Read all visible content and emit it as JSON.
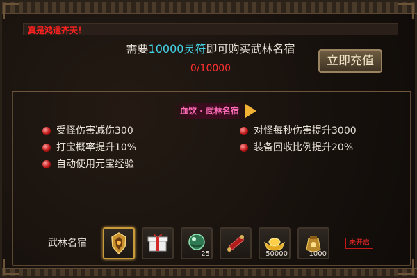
{
  "ticker": {
    "message": "真是鸿运齐天！"
  },
  "purchase": {
    "prefix": "需要",
    "amount_currency": "10000灵符",
    "suffix": "即可购买武林名宿",
    "progress": "0/10000"
  },
  "buttons": {
    "recharge_label": "立即充值"
  },
  "title_badge": {
    "label": "血饮 · 武林名宿"
  },
  "perks": {
    "left": [
      "受怪伤害减伤300",
      "打宝概率提升10%",
      "自动使用元宝经验"
    ],
    "right": [
      "对怪每秒伤害提升3000",
      "装备回收比例提升20%"
    ]
  },
  "reward_set": {
    "label": "武林名宿",
    "items": [
      {
        "icon": "golden-armor-icon",
        "qty": ""
      },
      {
        "icon": "gift-box-icon",
        "qty": ""
      },
      {
        "icon": "green-orb-icon",
        "qty": "25"
      },
      {
        "icon": "scroll-icon",
        "qty": ""
      },
      {
        "icon": "gold-ingot-icon",
        "qty": "50000"
      },
      {
        "icon": "coin-pouch-icon",
        "qty": "1000"
      }
    ],
    "status": "未开启"
  },
  "colors": {
    "accent_cyan": "#45d3e6",
    "alert_red": "#ff2020",
    "badge_pink": "#ff6bb7"
  }
}
